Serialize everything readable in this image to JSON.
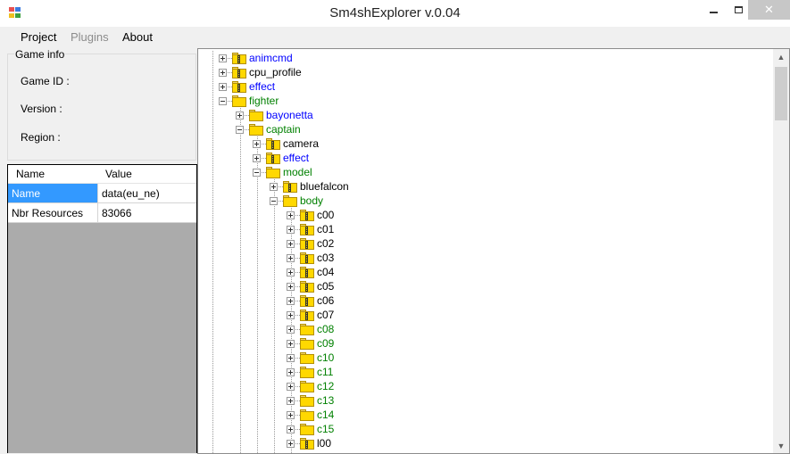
{
  "window": {
    "title": "Sm4shExplorer v.0.04",
    "close_glyph": "✕"
  },
  "menu": [
    "Project",
    "Plugins",
    "About"
  ],
  "menu_states": [
    "enabled",
    "disabled",
    "enabled"
  ],
  "game_info": {
    "legend": "Game info",
    "game_id_label": "Game ID :",
    "version_label": "Version :",
    "region_label": "Region :"
  },
  "properties": {
    "headers": [
      "Name",
      "Value"
    ],
    "rows": [
      {
        "name": "Name",
        "value": "data(eu_ne)"
      },
      {
        "name": "Nbr Resources",
        "value": "83066"
      }
    ]
  },
  "tree": {
    "nodes": [
      {
        "label": "animcmd",
        "depth": 0,
        "expander": "plus",
        "zip": true,
        "color": "#0000ff"
      },
      {
        "label": "cpu_profile",
        "depth": 0,
        "expander": "plus",
        "zip": true,
        "color": "#000000"
      },
      {
        "label": "effect",
        "depth": 0,
        "expander": "plus",
        "zip": true,
        "color": "#0000ff"
      },
      {
        "label": "fighter",
        "depth": 0,
        "expander": "minus",
        "zip": false,
        "color": "#008000"
      },
      {
        "label": "bayonetta",
        "depth": 1,
        "expander": "plus",
        "zip": false,
        "color": "#0000ff"
      },
      {
        "label": "captain",
        "depth": 1,
        "expander": "minus",
        "zip": false,
        "color": "#008000"
      },
      {
        "label": "camera",
        "depth": 2,
        "expander": "plus",
        "zip": true,
        "color": "#000000"
      },
      {
        "label": "effect",
        "depth": 2,
        "expander": "plus",
        "zip": true,
        "color": "#0000ff"
      },
      {
        "label": "model",
        "depth": 2,
        "expander": "minus",
        "zip": false,
        "color": "#008000"
      },
      {
        "label": "bluefalcon",
        "depth": 3,
        "expander": "plus",
        "zip": true,
        "color": "#000000"
      },
      {
        "label": "body",
        "depth": 3,
        "expander": "minus",
        "zip": false,
        "color": "#008000"
      },
      {
        "label": "c00",
        "depth": 4,
        "expander": "plus",
        "zip": true,
        "color": "#000000"
      },
      {
        "label": "c01",
        "depth": 4,
        "expander": "plus",
        "zip": true,
        "color": "#000000"
      },
      {
        "label": "c02",
        "depth": 4,
        "expander": "plus",
        "zip": true,
        "color": "#000000"
      },
      {
        "label": "c03",
        "depth": 4,
        "expander": "plus",
        "zip": true,
        "color": "#000000"
      },
      {
        "label": "c04",
        "depth": 4,
        "expander": "plus",
        "zip": true,
        "color": "#000000"
      },
      {
        "label": "c05",
        "depth": 4,
        "expander": "plus",
        "zip": true,
        "color": "#000000"
      },
      {
        "label": "c06",
        "depth": 4,
        "expander": "plus",
        "zip": true,
        "color": "#000000"
      },
      {
        "label": "c07",
        "depth": 4,
        "expander": "plus",
        "zip": true,
        "color": "#000000"
      },
      {
        "label": "c08",
        "depth": 4,
        "expander": "plus",
        "zip": false,
        "color": "#008000"
      },
      {
        "label": "c09",
        "depth": 4,
        "expander": "plus",
        "zip": false,
        "color": "#008000"
      },
      {
        "label": "c10",
        "depth": 4,
        "expander": "plus",
        "zip": false,
        "color": "#008000"
      },
      {
        "label": "c11",
        "depth": 4,
        "expander": "plus",
        "zip": false,
        "color": "#008000"
      },
      {
        "label": "c12",
        "depth": 4,
        "expander": "plus",
        "zip": false,
        "color": "#008000"
      },
      {
        "label": "c13",
        "depth": 4,
        "expander": "plus",
        "zip": false,
        "color": "#008000"
      },
      {
        "label": "c14",
        "depth": 4,
        "expander": "plus",
        "zip": false,
        "color": "#008000"
      },
      {
        "label": "c15",
        "depth": 4,
        "expander": "plus",
        "zip": false,
        "color": "#008000"
      },
      {
        "label": "l00",
        "depth": 4,
        "expander": "plus",
        "zip": true,
        "color": "#000000"
      }
    ]
  },
  "scrollbar": {
    "up_glyph": "▲",
    "down_glyph": "▼"
  }
}
